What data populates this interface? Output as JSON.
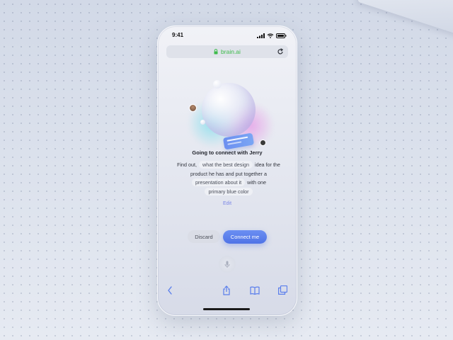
{
  "status_bar": {
    "time": "9:41"
  },
  "browser": {
    "url": "brain.ai"
  },
  "assistant": {
    "heading": "Going to connect with Jerry",
    "prompt": {
      "part1": "Find out,",
      "chip1": "what the best design",
      "part2": "idea for the product he has and put together a",
      "chip2": "presentation about it",
      "part3": "with one",
      "chip3": "primary blue color"
    },
    "edit_label": "Edit"
  },
  "actions": {
    "discard_label": "Discard",
    "connect_label": "Connect me"
  },
  "toolbar": {
    "icons": [
      "back-icon",
      "share-icon",
      "bookmarks-icon",
      "tabs-icon"
    ]
  },
  "colors": {
    "accent": "#5b7fec",
    "url_green": "#3dbb4b",
    "edit_link": "#7b86e6"
  }
}
